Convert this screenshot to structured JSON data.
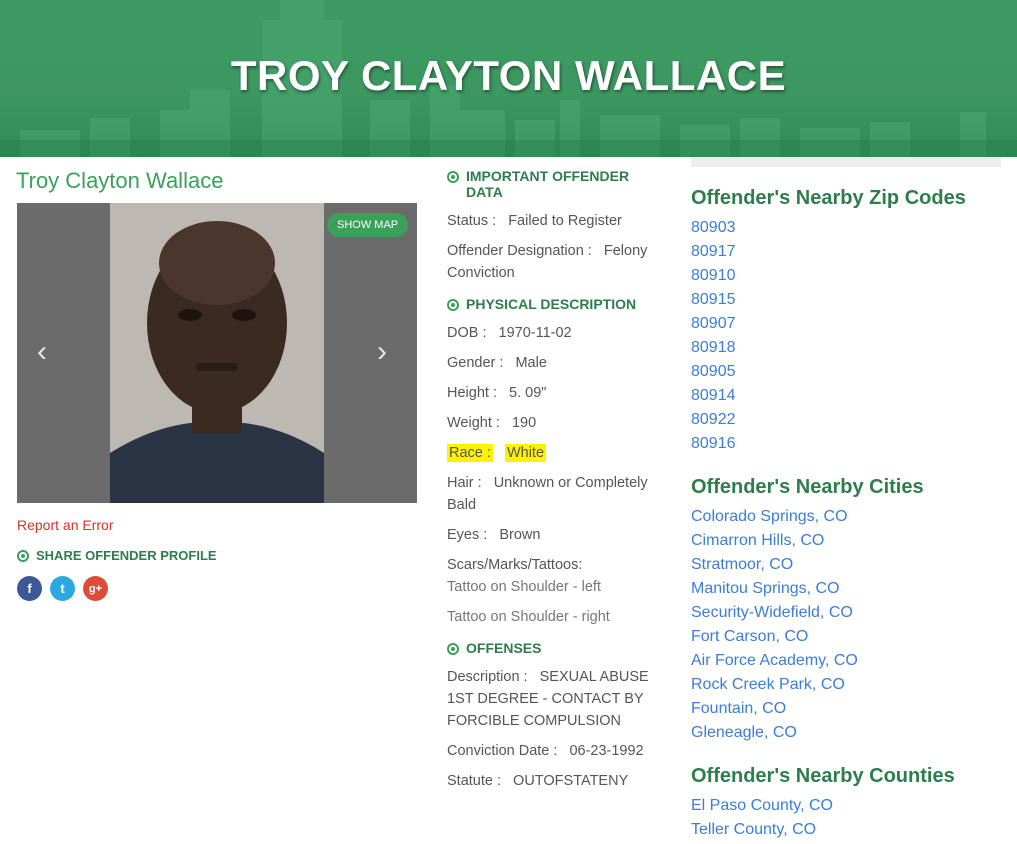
{
  "header": {
    "title": "TROY CLAYTON WALLACE"
  },
  "profile": {
    "name": "Troy Clayton Wallace",
    "show_map": "SHOW MAP",
    "report_error": "Report an Error",
    "share_label": "SHARE OFFENDER PROFILE",
    "socials": {
      "facebook": "f",
      "twitter": "t",
      "google": "g+"
    },
    "prev_arrow": "‹",
    "next_arrow": "›"
  },
  "important": {
    "heading": "IMPORTANT OFFENDER DATA",
    "status_label": "Status :",
    "status_value": "Failed to Register",
    "designation_label": "Offender Designation :",
    "designation_value": "Felony Conviction"
  },
  "physical": {
    "heading": "PHYSICAL DESCRIPTION",
    "dob_label": "DOB :",
    "dob_value": "1970-11-02",
    "gender_label": "Gender :",
    "gender_value": "Male",
    "height_label": "Height :",
    "height_value": "5. 09\"",
    "weight_label": "Weight :",
    "weight_value": "190",
    "race_label": "Race :",
    "race_value": "White",
    "hair_label": "Hair :",
    "hair_value": "Unknown or Completely Bald",
    "eyes_label": "Eyes :",
    "eyes_value": "Brown",
    "scars_label": "Scars/Marks/Tattoos:",
    "scars": [
      "Tattoo on Shoulder - left",
      "Tattoo on Shoulder - right"
    ]
  },
  "offenses": {
    "heading": "OFFENSES",
    "desc_label": "Description :",
    "desc_value": "SEXUAL ABUSE 1ST DEGREE - CONTACT BY FORCIBLE COMPULSION",
    "conv_label": "Conviction Date :",
    "conv_value": "06-23-1992",
    "statute_label": "Statute :",
    "statute_value": "OUTOFSTATENY"
  },
  "nearby": {
    "zip_heading": "Offender's Nearby Zip Codes",
    "zips": [
      "80903",
      "80917",
      "80910",
      "80915",
      "80907",
      "80918",
      "80905",
      "80914",
      "80922",
      "80916"
    ],
    "cities_heading": "Offender's Nearby Cities",
    "cities": [
      "Colorado Springs, CO",
      "Cimarron Hills, CO",
      "Stratmoor, CO",
      "Manitou Springs, CO",
      "Security-Widefield, CO",
      "Fort Carson, CO",
      "Air Force Academy, CO",
      "Rock Creek Park, CO",
      "Fountain, CO",
      "Gleneagle, CO"
    ],
    "counties_heading": "Offender's Nearby Counties",
    "counties": [
      "El Paso County, CO",
      "Teller County, CO"
    ]
  },
  "colors": {
    "brand_green": "#3aa05a",
    "link_blue": "#3b7dd8",
    "highlight": "#fff200",
    "error_red": "#d9302b"
  }
}
